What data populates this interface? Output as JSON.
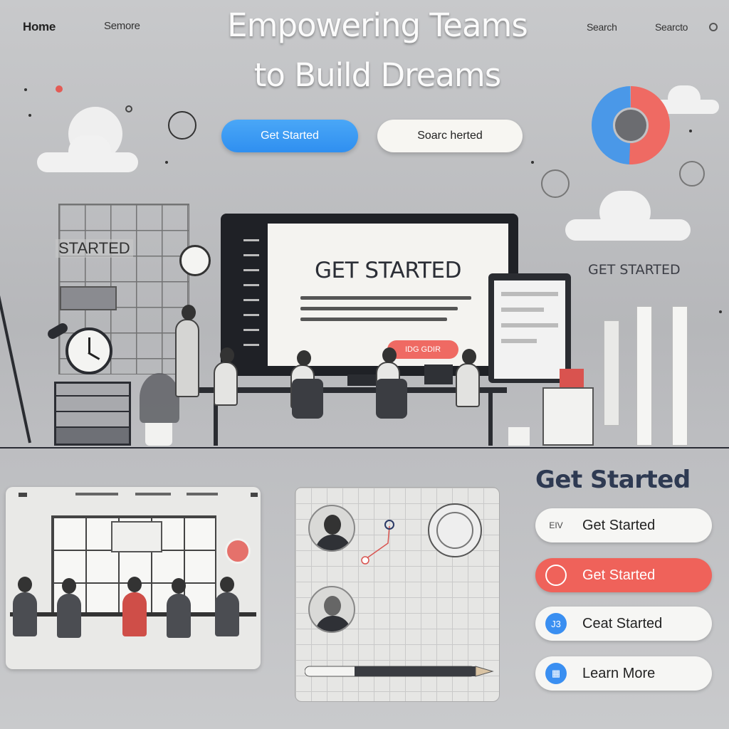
{
  "nav": {
    "home": "Home",
    "more": "Semore",
    "search": "Search",
    "search2": "Searcto",
    "toggle_icon": "circle-dot-icon"
  },
  "hero": {
    "title_line1": "Empowering Teams",
    "title_line2": "to Build Dreams",
    "primary_button": "Get Started",
    "secondary_button": "Soarc herted"
  },
  "monitor": {
    "title": "GET STARTED",
    "button": "IDG GDIR"
  },
  "whiteboard": {
    "label": "STARTED"
  },
  "right_panel": {
    "label": "GET STARTED"
  },
  "cta": {
    "heading": "Get Started",
    "items": [
      {
        "label": "Get Started",
        "icon": "EIV",
        "style": "white"
      },
      {
        "label": "Get Started",
        "icon": "",
        "style": "red"
      },
      {
        "label": "Ceat Started",
        "icon": "J3",
        "style": "blue"
      },
      {
        "label": "Learn More",
        "icon": "",
        "style": "blue"
      }
    ]
  },
  "colors": {
    "accent_blue": "#3a8ff1",
    "accent_red": "#ef625a",
    "heading_navy": "#2e3a52"
  }
}
